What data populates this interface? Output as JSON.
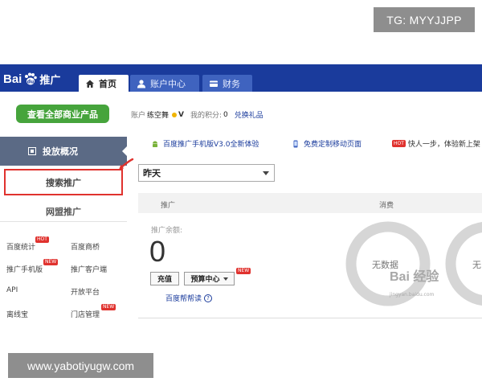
{
  "overlays": {
    "tg_label": "TG: MYYJJPP",
    "site_url": "www.yabotiyugw.com"
  },
  "header": {
    "logo_text": "Bai",
    "logo_paw_icon": "paw-icon",
    "logo_suffix": "推广",
    "tabs": [
      {
        "label": "首页",
        "icon": "home-icon",
        "active": true
      },
      {
        "label": "账户中心",
        "icon": "user-icon",
        "active": false
      },
      {
        "label": "财务",
        "icon": "wallet-icon",
        "active": false
      }
    ]
  },
  "account": {
    "view_all_button": "查看全部商业产品",
    "account_label": "账户",
    "account_name": "练空舞",
    "verified_mark": "V",
    "points_label": "我的积分:",
    "points_value": "0",
    "redeem_link": "兑换礼品"
  },
  "sidebar": {
    "overview": "投放概况",
    "search_promo": "搜索推广",
    "network_promo": "网盟推广",
    "tools": [
      {
        "label": "百度统计",
        "badge": "HOT"
      },
      {
        "label": "百度商桥",
        "badge": ""
      },
      {
        "label": "推广手机版",
        "badge": "NEW"
      },
      {
        "label": "推广客户端",
        "badge": ""
      },
      {
        "label": "API",
        "badge": ""
      },
      {
        "label": "开放平台",
        "badge": ""
      },
      {
        "label": "离线宝",
        "badge": ""
      },
      {
        "label": "门店管理",
        "badge": "NEW"
      }
    ]
  },
  "notices": [
    {
      "text": "百度推广手机版V3.0全新体验",
      "icon": "android-icon"
    },
    {
      "text": "免费定制移动页面",
      "icon": "phone-icon"
    },
    {
      "badge": "HOT",
      "text": "快人一步，体验新上架"
    }
  ],
  "main": {
    "date_select": "昨天",
    "col_promo": "推广",
    "col_spend": "消费",
    "balance_label": "推广余额:",
    "balance_value": "0",
    "recharge_button": "充值",
    "budget_button": "预算中心",
    "budget_badge": "NEW",
    "help_link": "百度帮帮读",
    "help_icon": "?",
    "no_data": "无数据",
    "no_data_partial": "无",
    "ring_color": "#d6d6d6"
  },
  "watermark": {
    "text": "Bai 经验",
    "sub": "jingyan.baidu.com"
  },
  "colors": {
    "topbar": "#1a3b9c",
    "green_button": "#46a43c",
    "highlight_red": "#e0322e",
    "sidebar_active": "#5b6a85"
  }
}
